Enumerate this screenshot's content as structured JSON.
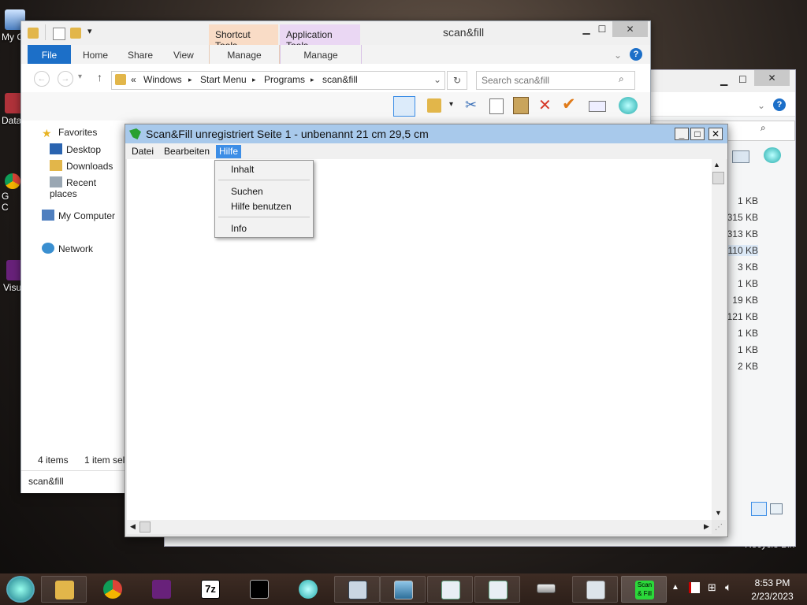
{
  "desktop": {
    "icons": [
      {
        "label": "My C"
      },
      {
        "label": "Data"
      },
      {
        "label": "G\nC"
      },
      {
        "label": "Visu"
      }
    ],
    "recycle_label": "Recycle Bin"
  },
  "explorer": {
    "title": "scan&fill",
    "contextual_tabs": {
      "shortcut": "Shortcut Tools",
      "application": "Application Tools"
    },
    "tabs": {
      "file": "File",
      "home": "Home",
      "share": "Share",
      "view": "View",
      "manage1": "Manage",
      "manage2": "Manage"
    },
    "breadcrumb": {
      "prefix": "«",
      "items": [
        "Windows",
        "Start Menu",
        "Programs",
        "scan&fill"
      ]
    },
    "search_placeholder": "Search scan&fill",
    "nav": {
      "favorites": "Favorites",
      "desktop": "Desktop",
      "downloads": "Downloads",
      "recent": "Recent places",
      "computer": "My Computer",
      "network": "Network"
    },
    "status": {
      "items": "4 items",
      "selected": "1 item sel"
    },
    "path_label": "scan&fill"
  },
  "back_window": {
    "sizes": [
      "1 KB",
      "315 KB",
      "313 KB",
      "110 KB",
      "3 KB",
      "1 KB",
      "19 KB",
      "121 KB",
      "1 KB",
      "1 KB",
      "2 KB"
    ]
  },
  "scanfill": {
    "title": "Scan&Fill unregistriert Seite 1 - unbenannt 21 cm 29,5 cm",
    "menu": {
      "datei": "Datei",
      "bearbeiten": "Bearbeiten",
      "hilfe": "Hilfe"
    },
    "help_menu": {
      "inhalt": "Inhalt",
      "suchen": "Suchen",
      "hilfe_benutzen": "Hilfe benutzen",
      "info": "Info"
    }
  },
  "taskbar": {
    "scanfill_label": "Scan & Fill",
    "time": "8:53 PM",
    "date": "2/23/2023"
  },
  "colors": {
    "title_active": "#a8c9eb",
    "menu_highlight": "#3d8ee6",
    "ribbon_file": "#1c6fc8",
    "shortcut_tools": "#f9dcc6",
    "application_tools": "#ead7f3"
  }
}
